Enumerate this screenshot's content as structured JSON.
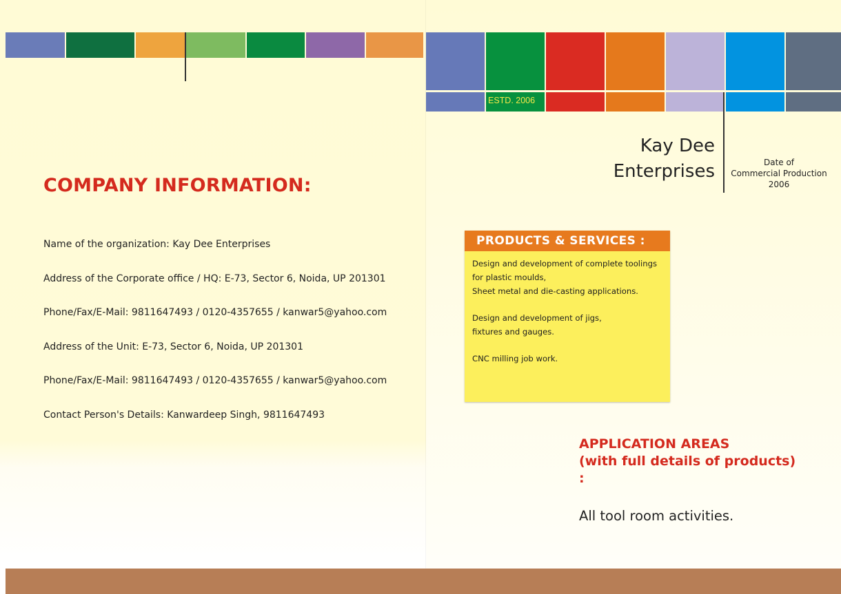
{
  "brand": {
    "estd": "ESTD. 2006",
    "company_line1": "Kay Dee",
    "company_line2": "Enterprises",
    "production_date": [
      "Date of",
      "Commercial Production",
      "2006"
    ]
  },
  "company_info": {
    "heading": "COMPANY INFORMATION:",
    "lines": [
      "Name of the organization: Kay Dee Enterprises",
      "Address of the Corporate office / HQ: E-73, Sector  6, Noida, UP 201301",
      "Phone/Fax/E-Mail: 9811647493 / 0120-4357655 / kanwar5@yahoo.com",
      "Address of the Unit: E-73, Sector  6, Noida, UP 201301",
      "Phone/Fax/E-Mail: 9811647493 / 0120-4357655 / kanwar5@yahoo.com",
      "Contact Person's Details: Kanwardeep Singh, 9811647493"
    ]
  },
  "products_services": {
    "heading": "PRODUCTS & SERVICES :",
    "lines": [
      "Design and development of complete toolings",
      "for plastic moulds,",
      "Sheet metal and die-casting applications.",
      "",
      "Design and development of jigs,",
      "fixtures and gauges.",
      "",
      "CNC milling job work."
    ]
  },
  "application_areas": {
    "heading_lines": [
      "APPLICATION AREAS",
      "(with full details of products)",
      ":"
    ],
    "text": "All tool room activities."
  },
  "colors": {
    "accent_red": "#d42a1e",
    "orange": "#e77a1e",
    "note_yellow": "#fcef5c",
    "footer_brown": "#b77e56",
    "left_strip": [
      "#6a7cb8",
      "#0f7040",
      "#eea43e",
      "#7ebb60",
      "#0a8a40",
      "#8e68a8",
      "#e99646"
    ],
    "right_grid": [
      "#6679b8",
      "#07913e",
      "#da2b22",
      "#e5791c",
      "#bcb3d9",
      "#0293e0",
      "#5f6e82"
    ]
  }
}
